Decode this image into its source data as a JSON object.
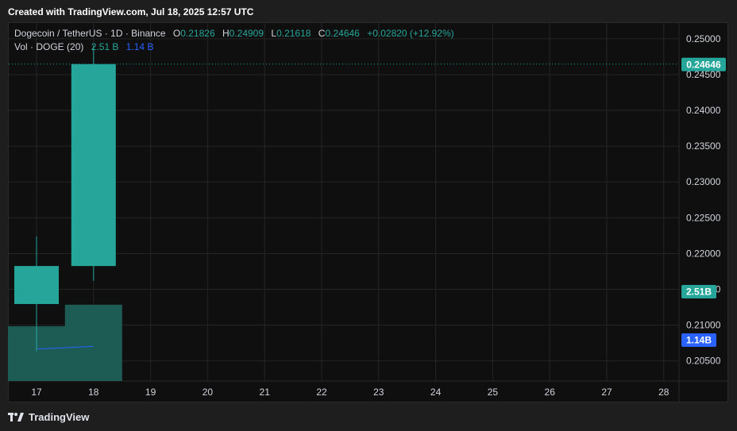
{
  "header": {
    "created_text": "Created with TradingView.com, Jul 18, 2025 12:57 UTC"
  },
  "legend": {
    "symbol": "Dogecoin / TetherUS · 1D · Binance",
    "o_label": "O",
    "o_value": "0.21826",
    "h_label": "H",
    "h_value": "0.24909",
    "l_label": "L",
    "l_value": "0.21618",
    "c_label": "C",
    "c_value": "0.24646",
    "change": "+0.02820 (+12.92%)",
    "vol_label": "Vol · DOGE (20)",
    "vol_value": "2.51 B",
    "vol_ma_value": "1.14 B"
  },
  "footer": {
    "brand": "TradingView"
  },
  "colors": {
    "up": "#26a69a",
    "volume": "#1d5c55",
    "ma_line": "#2962ff",
    "background": "#0f0f0f",
    "grid": "#252525"
  },
  "chart_data": {
    "type": "candlestick",
    "x_ticks": [
      "17",
      "18",
      "19",
      "20",
      "21",
      "22",
      "23",
      "24",
      "25",
      "26",
      "27",
      "28"
    ],
    "y_ticks": [
      "0.20500",
      "0.21000",
      "0.21500",
      "0.22000",
      "0.22500",
      "0.23000",
      "0.23500",
      "0.24000",
      "0.24500",
      "0.25000"
    ],
    "ylim": [
      0.2022,
      0.2522
    ],
    "candles": [
      {
        "x": "17",
        "open": 0.21295,
        "high": 0.2224,
        "low": 0.20639,
        "close": 0.21826
      },
      {
        "x": "18",
        "open": 0.21826,
        "high": 0.24909,
        "low": 0.21618,
        "close": 0.24646
      }
    ],
    "volume": [
      {
        "x": "17",
        "value": 1.8
      },
      {
        "x": "18",
        "value": 2.51
      }
    ],
    "volume_ma": [
      {
        "x": "17",
        "value": 1.05
      },
      {
        "x": "18",
        "value": 1.14
      }
    ],
    "volume_max": 4.7,
    "last_price_label": "0.24646",
    "last_volume_label": "2.51B",
    "volume_ma_label": "1.14B"
  }
}
